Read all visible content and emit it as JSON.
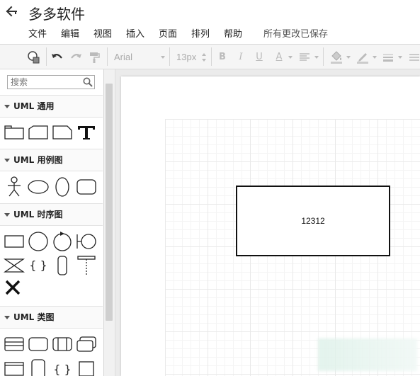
{
  "header": {
    "title": "多多软件",
    "menu": [
      "文件",
      "编辑",
      "视图",
      "插入",
      "页面",
      "排列",
      "帮助"
    ],
    "save_status": "所有更改已保存"
  },
  "toolbar": {
    "font_name": "Arial",
    "font_size": "13px",
    "bold": "B",
    "italic": "I",
    "underline": "U",
    "font_color": "A"
  },
  "sidebar": {
    "search_placeholder": "搜索",
    "sections": [
      {
        "title": "UML 通用",
        "shapes": [
          "folder",
          "tab-folder",
          "note",
          "text"
        ]
      },
      {
        "title": "UML 用例图",
        "shapes": [
          "actor",
          "use-case-ellipse",
          "vertical-ellipse",
          "rounded-rect"
        ]
      },
      {
        "title": "UML 时序图",
        "shapes": [
          "rect",
          "circle",
          "circle-arrow",
          "boundary",
          "hourglass",
          "braces",
          "lifeline-pill",
          "lifeline",
          "destroy-x"
        ]
      },
      {
        "title": "UML 类图",
        "shapes": [
          "class",
          "rounded-class",
          "module",
          "stack",
          "frame",
          "tall-rounded",
          "braces",
          "square"
        ]
      }
    ]
  },
  "canvas": {
    "shape_label": "12312"
  },
  "colors": {
    "toolbar_bg": "#f5f5f5",
    "canvas_bg": "#ebebeb",
    "grid_line": "#e9e9e9"
  }
}
